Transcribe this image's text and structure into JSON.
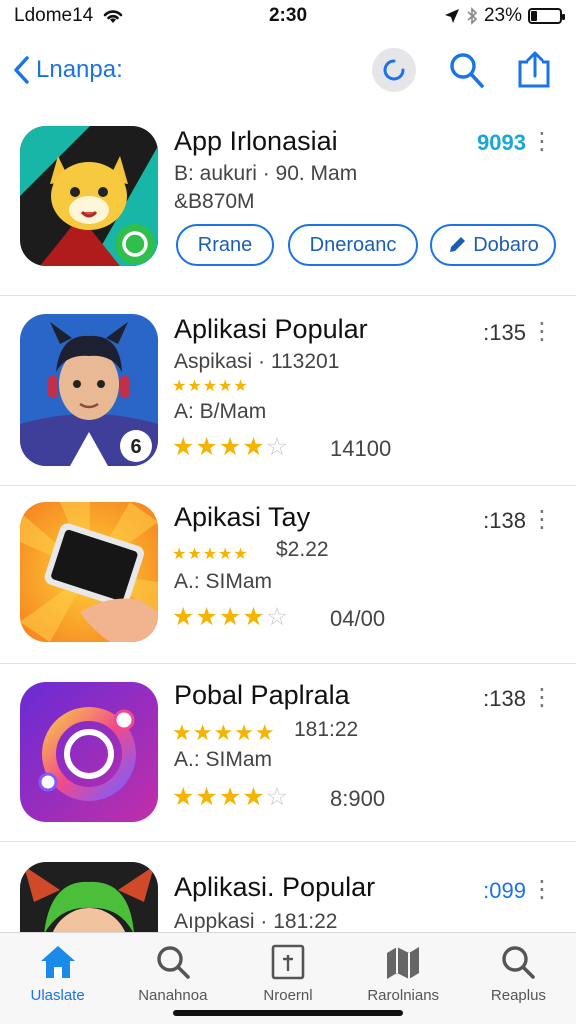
{
  "status_bar": {
    "carrier": "Ldome14",
    "time": "2:30",
    "battery_percent": "23%",
    "battery_level": 0.23
  },
  "nav": {
    "back_label": "Lnanpa:",
    "icons": [
      "back-chevron-icon",
      "loading-icon",
      "search-icon",
      "share-icon"
    ]
  },
  "apps": [
    {
      "title": "App Irlonasiai",
      "count": "9093",
      "line1": "B: aukuri · 90. Mam",
      "line2": "&B870M",
      "actions": [
        {
          "label": "Rrane",
          "icon": ""
        },
        {
          "label": "Dneroanc",
          "icon": ""
        },
        {
          "label": "Dobaro",
          "icon": "pencil-icon"
        }
      ],
      "icon": "fox-mascot-icon"
    },
    {
      "title": "Aplikasi Popular",
      "count": ":135",
      "line1": "Aspikasi · 113201",
      "line2": "A: B/Mam",
      "rating": 4,
      "rating_count": "14100",
      "icon": "avatar-headphones-icon"
    },
    {
      "title": "Apikasi Tay",
      "count": ":138",
      "line1": "$2.22",
      "line2": "A.: SIMam",
      "rating": 4,
      "rating_count": "04/00",
      "icon": "phone-hand-icon"
    },
    {
      "title": "Pobal Paplrala",
      "count": ":138",
      "line1": "181:22",
      "line2": "A.: SIMam",
      "rating": 4,
      "rating_count": "8:900",
      "icon": "gradient-ring-icon"
    },
    {
      "title": "Aplikasi. Popular",
      "count": ":099",
      "line1": "Aıppkasi · 181:22",
      "icon": "green-hair-avatar-icon"
    }
  ],
  "tabs": [
    {
      "label": "Ulaslate",
      "icon": "home-icon",
      "active": true
    },
    {
      "label": "Nanahnoa",
      "icon": "search-icon",
      "active": false
    },
    {
      "label": "Nroernl",
      "icon": "info-card-icon",
      "active": false
    },
    {
      "label": "Rarolnians",
      "icon": "map-icon",
      "active": false
    },
    {
      "label": "Reaplus",
      "icon": "search-icon",
      "active": false
    }
  ]
}
